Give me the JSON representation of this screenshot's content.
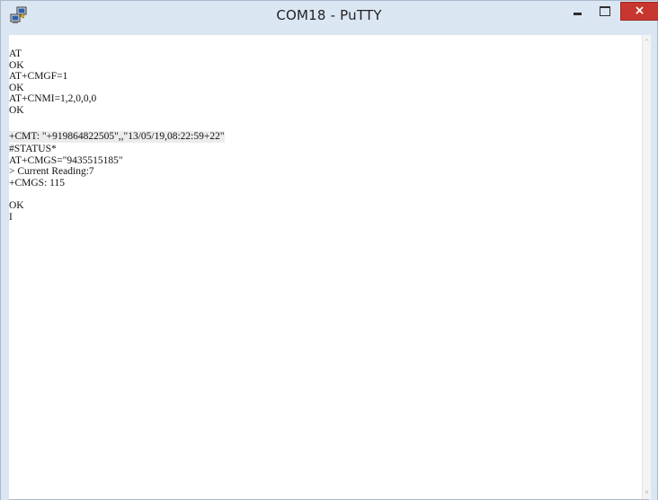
{
  "window": {
    "title": "COM18 - PuTTY",
    "app_icon": "putty-icon",
    "controls": {
      "minimize_icon": "minimize-icon",
      "maximize_icon": "maximize-icon",
      "close_icon": "close-icon",
      "close_label": "×"
    },
    "colors": {
      "titlebar": "#dbe6f3",
      "close_button": "#c7372f",
      "terminal_bg": "#ffffff",
      "terminal_text": "#111111"
    }
  },
  "terminal": {
    "lines": [
      "AT",
      "OK",
      "AT+CMGF=1",
      "OK",
      "AT+CNMI=1,2,0,0,0",
      "OK",
      "",
      "+CMT: \"+919864822505\",,\"13/05/19,08:22:59+22\"",
      "#STATUS*",
      "AT+CMGS=\"9435515185\"",
      "> Current Reading:7",
      "+CMGS: 115",
      "",
      "OK",
      "I"
    ]
  },
  "scrollbar": {
    "up_glyph": "^",
    "down_glyph": "v"
  }
}
